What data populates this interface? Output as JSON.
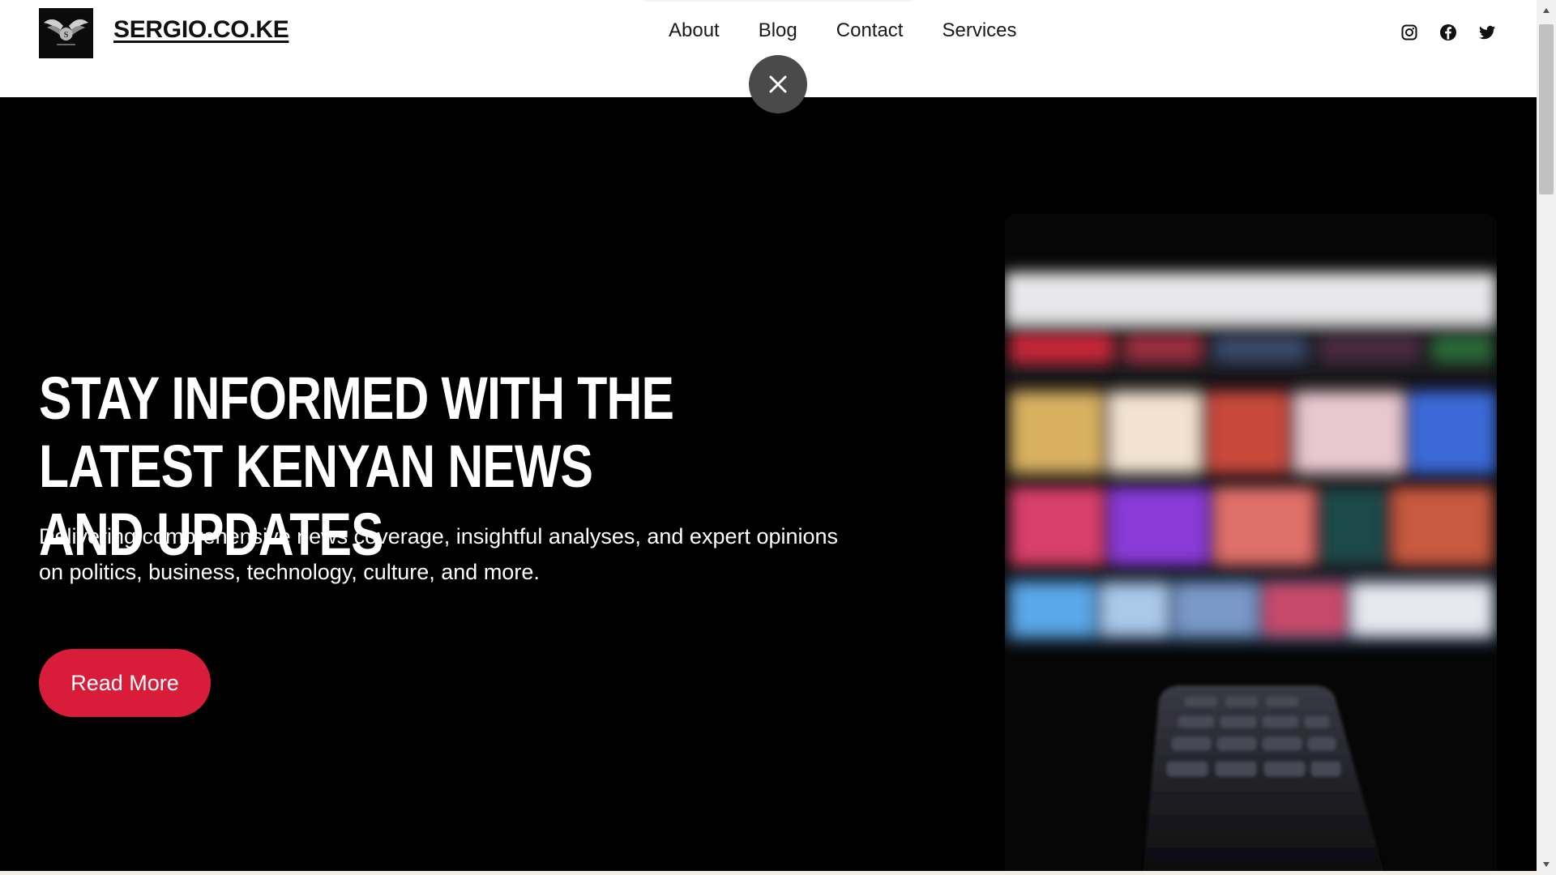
{
  "header": {
    "site_title": "SERGIO.CO.KE",
    "nav": [
      "About",
      "Blog",
      "Contact",
      "Services"
    ],
    "social_icons": [
      "instagram-icon",
      "facebook-icon",
      "twitter-icon"
    ],
    "close_icon": "close-icon"
  },
  "hero": {
    "title": "STAY INFORMED WITH THE LATEST KENYAN NEWS AND UPDATES",
    "description": "Delivering comprehensive news coverage, insightful analyses, and expert opinions on politics, business, technology, culture, and more.",
    "cta_label": "Read More"
  },
  "colors": {
    "accent": "#d91c3a",
    "hero_background": "#000000",
    "header_background": "#ffffff",
    "close_button": "#4a4a4a"
  }
}
